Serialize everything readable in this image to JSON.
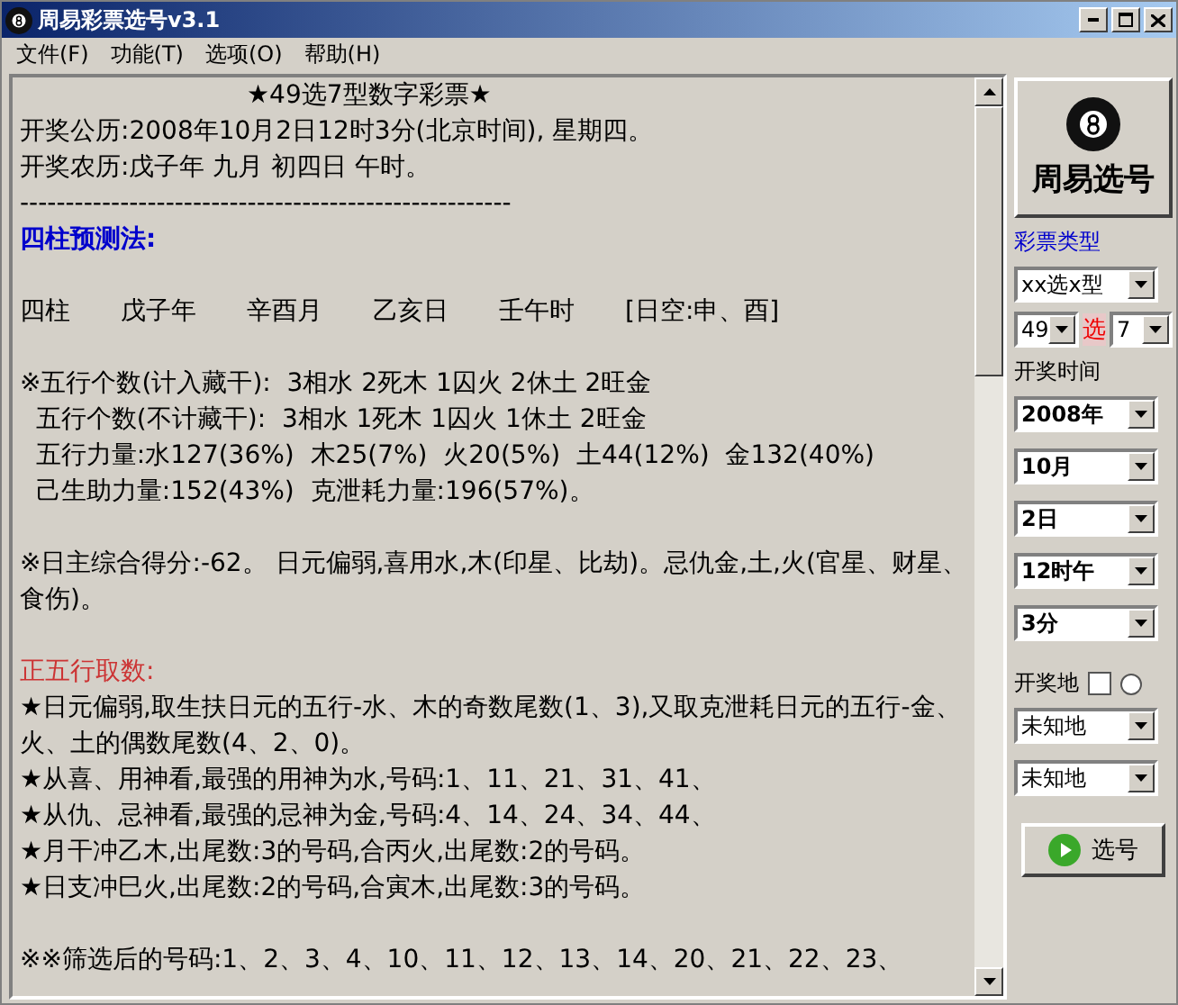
{
  "window": {
    "title": "周易彩票选号v3.1"
  },
  "menu": [
    "文件(F)",
    "功能(T)",
    "选项(O)",
    "帮助(H)"
  ],
  "document": {
    "blocks": [
      {
        "lines": [
          {
            "kind": "title",
            "text": "★49选7型数字彩票★"
          },
          {
            "kind": "text",
            "text": "开奖公历:2008年10月2日12时3分(北京时间), 星期四。"
          },
          {
            "kind": "text",
            "text": "开奖农历:戊子年 九月 初四日 午时。"
          },
          {
            "kind": "rule",
            "text": "------------------------------------------------------"
          },
          {
            "kind": "blue-heading",
            "text": "四柱预测法:"
          }
        ]
      },
      {
        "lines": [
          {
            "kind": "columns",
            "cells": [
              "四柱",
              "戊子年",
              "辛酉月",
              "乙亥日",
              "壬午时",
              "[日空:申、酉]"
            ]
          }
        ]
      },
      {
        "lines": [
          {
            "kind": "text",
            "text": "※五行个数(计入藏干):  3相水 2死木 1囚火 2休土 2旺金"
          },
          {
            "kind": "text",
            "text": "  五行个数(不计藏干):  3相水 1死木 1囚火 1休土 2旺金"
          },
          {
            "kind": "text",
            "text": "  五行力量:水127(36%)  木25(7%)  火20(5%)  土44(12%)  金132(40%)"
          },
          {
            "kind": "text",
            "text": "  己生助力量:152(43%)  克泄耗力量:196(57%)。"
          }
        ]
      },
      {
        "lines": [
          {
            "kind": "text",
            "text": "※日主综合得分:-62。 日元偏弱,喜用水,木(印星、比劫)。忌仇金,土,火(官星、财星、食伤)。"
          }
        ]
      },
      {
        "lines": [
          {
            "kind": "red-heading",
            "text": "正五行取数:"
          },
          {
            "kind": "text",
            "text": "★日元偏弱,取生扶日元的五行-水、木的奇数尾数(1、3),又取克泄耗日元的五行-金、火、土的偶数尾数(4、2、0)。"
          },
          {
            "kind": "text",
            "text": "★从喜、用神看,最强的用神为水,号码:1、11、21、31、41、"
          },
          {
            "kind": "text",
            "text": "★从仇、忌神看,最强的忌神为金,号码:4、14、24、34、44、"
          },
          {
            "kind": "text",
            "text": "★月干冲乙木,出尾数:3的号码,合丙火,出尾数:2的号码。"
          },
          {
            "kind": "text",
            "text": "★日支冲巳火,出尾数:2的号码,合寅木,出尾数:3的号码。"
          }
        ]
      },
      {
        "lines": [
          {
            "kind": "text",
            "text": "※※筛选后的号码:1、2、3、4、10、11、12、13、14、20、21、22、23、"
          }
        ]
      }
    ]
  },
  "panel": {
    "logo_label": "周易选号",
    "type_label": "彩票类型",
    "type_select": "xx选x型",
    "pick_from": "49",
    "pick_word": "选",
    "pick_count": "7",
    "time_label": "开奖时间",
    "time_selects": [
      "2008年",
      "10月",
      "2日",
      "12时午",
      "3分"
    ],
    "place_label": "开奖地",
    "place_checked": false,
    "place_radio_selected": false,
    "place_selects": [
      "未知地",
      "未知地"
    ],
    "go_button": "选号"
  }
}
